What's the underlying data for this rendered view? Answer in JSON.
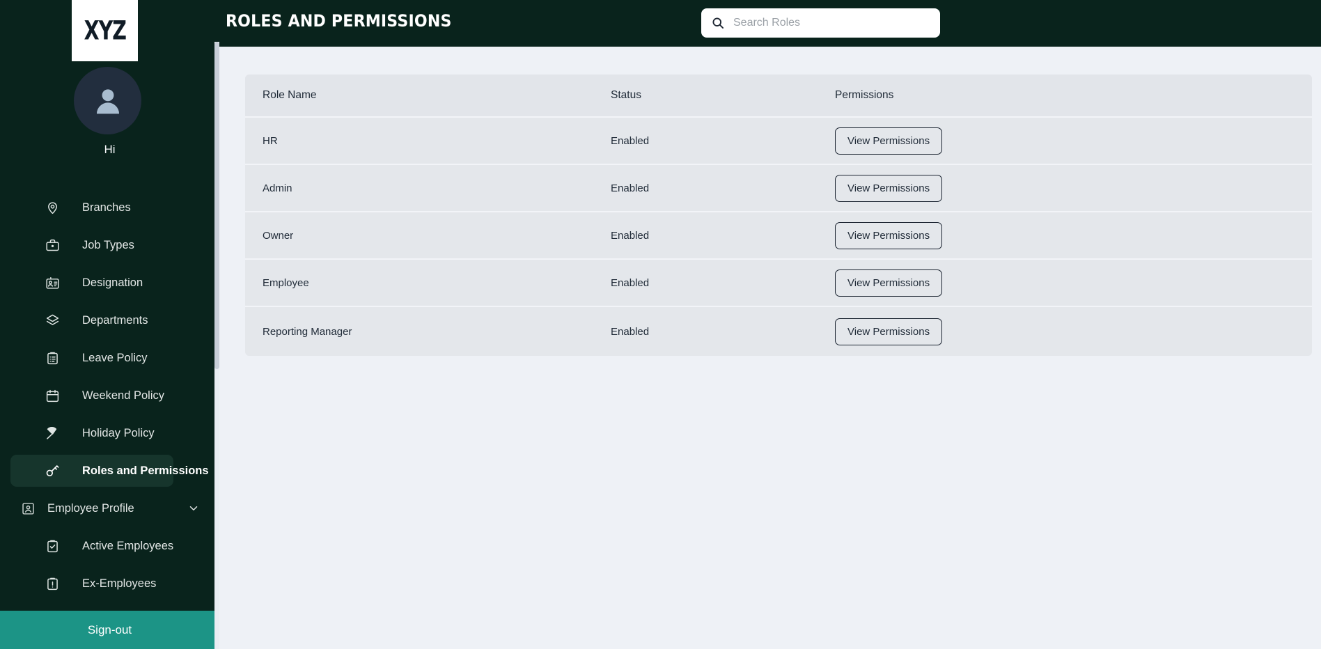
{
  "brand": {
    "logo_text": "XYZ",
    "sidebar_bg": "#09231c",
    "accent": "#1c9486",
    "page_bg": "#eef1f6",
    "row_bg": "#e4e7eb"
  },
  "sidebar": {
    "greeting": "Hi",
    "avatar_icon": "user-avatar-icon",
    "items": [
      {
        "label": "Branches",
        "icon": "map-pin-icon",
        "active": false,
        "type": "item"
      },
      {
        "label": "Job Types",
        "icon": "briefcase-icon",
        "active": false,
        "type": "item"
      },
      {
        "label": "Designation",
        "icon": "id-card-icon",
        "active": false,
        "type": "item"
      },
      {
        "label": "Departments",
        "icon": "layers-icon",
        "active": false,
        "type": "item"
      },
      {
        "label": "Leave Policy",
        "icon": "clipboard-list-icon",
        "active": false,
        "type": "item"
      },
      {
        "label": "Weekend Policy",
        "icon": "calendar-icon",
        "active": false,
        "type": "item"
      },
      {
        "label": "Holiday Policy",
        "icon": "beach-umbrella-icon",
        "active": false,
        "type": "item"
      },
      {
        "label": "Roles and Permissions",
        "icon": "key-icon",
        "active": true,
        "type": "item"
      },
      {
        "label": "Employee Profile",
        "icon": "user-square-icon",
        "active": false,
        "type": "group",
        "chevron": "chevron-down-icon"
      },
      {
        "label": "Active Employees",
        "icon": "clipboard-check-icon",
        "active": false,
        "type": "item"
      },
      {
        "label": "Ex-Employees",
        "icon": "clipboard-alert-icon",
        "active": false,
        "type": "item"
      }
    ],
    "signout_label": "Sign-out"
  },
  "topbar": {
    "menu_icon": "hamburger-menu-icon",
    "title": "ROLES AND PERMISSIONS",
    "search": {
      "icon": "search-icon",
      "placeholder": "Search Roles",
      "value": ""
    }
  },
  "table": {
    "columns": [
      "Role Name",
      "Status",
      "Permissions"
    ],
    "rows": [
      {
        "role": "HR",
        "status": "Enabled",
        "action": "View Permissions"
      },
      {
        "role": "Admin",
        "status": "Enabled",
        "action": "View Permissions"
      },
      {
        "role": "Owner",
        "status": "Enabled",
        "action": "View Permissions"
      },
      {
        "role": "Employee",
        "status": "Enabled",
        "action": "View Permissions"
      },
      {
        "role": "Reporting Manager",
        "status": "Enabled",
        "action": "View Permissions"
      }
    ]
  }
}
